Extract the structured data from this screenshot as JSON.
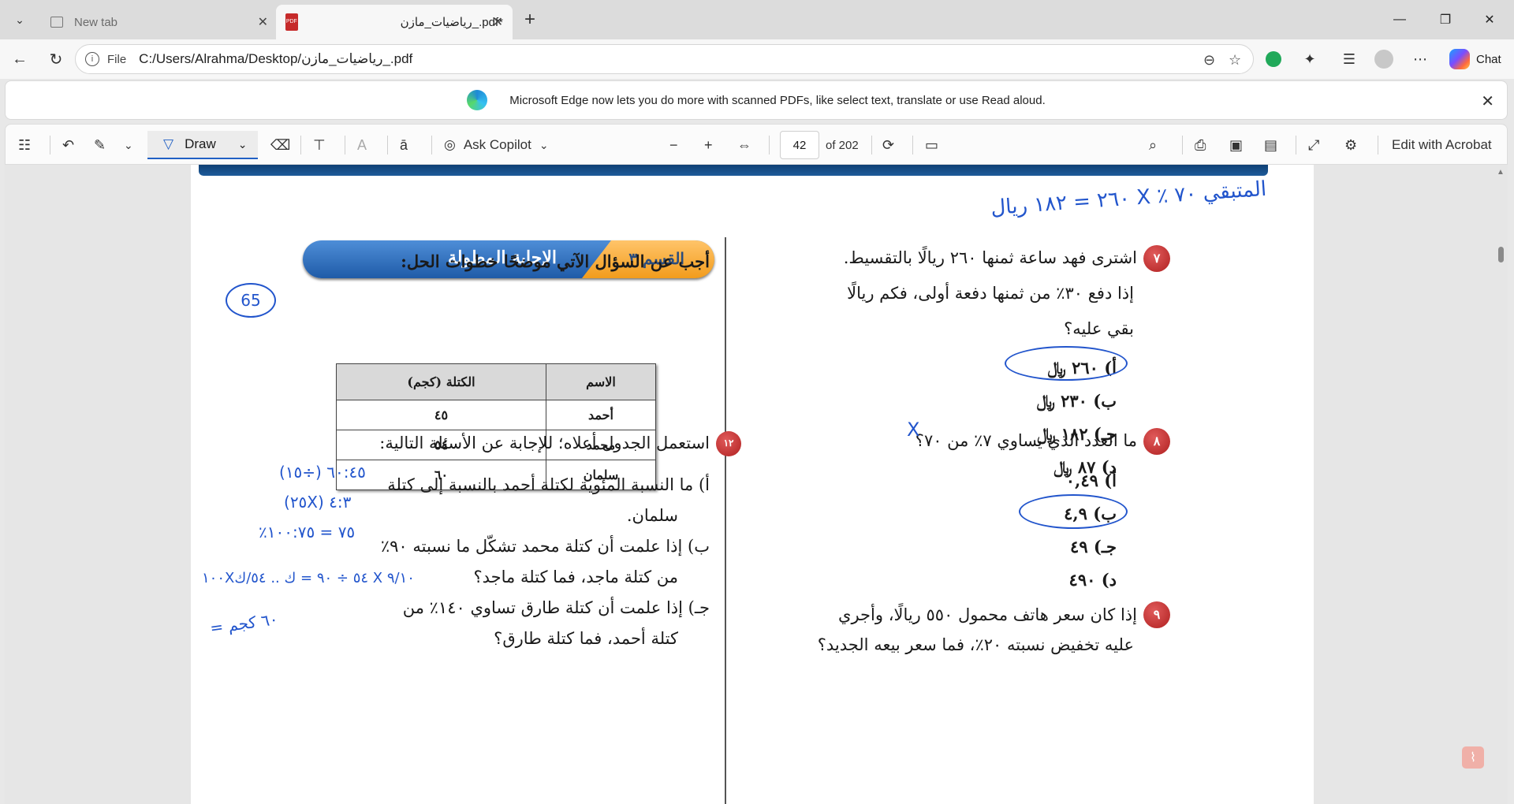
{
  "tabs": {
    "inactive": {
      "label": "New tab"
    },
    "active": {
      "label": "رياضيات_مازن_.pdf*"
    }
  },
  "address": {
    "scheme_label": "File",
    "url": "C:/Users/Alrahma/Desktop/رياضيات_مازن_.pdf"
  },
  "chat_label": "Chat",
  "infobar": {
    "message": "Microsoft Edge now lets you do more with scanned PDFs, like select text, translate or use Read aloud."
  },
  "pdf_toolbar": {
    "draw_label": "Draw",
    "copilot_label": "Ask Copilot",
    "page_current": "42",
    "page_total": "of 202",
    "acrobat_label": "Edit with Acrobat"
  },
  "colors": {
    "ink": "#2255cc",
    "accent": "#2160c4",
    "qnum": "#b02020"
  },
  "doc": {
    "right": {
      "q7": {
        "num": "٧",
        "line1": "اشترى فهد ساعة ثمنها ٢٦٠ ريالًا بالتقسيط.",
        "line2": "إذا دفع ٣٠٪ من ثمنها دفعة أولى، فكم ريالًا",
        "line3": "بقي عليه؟",
        "options": [
          "أ)  ٢٦٠ ﷼",
          "ب)  ٢٣٠ ﷼",
          "جـ)  ١٨٢ ﷼",
          "د)  ٨٧ ﷼"
        ]
      },
      "q8": {
        "num": "٨",
        "text": "ما العدد الذي يساوي ٧٪ من ٧٠؟",
        "options": [
          "أ)  ٠,٤٩",
          "ب)  ٤,٩",
          "جـ)  ٤٩",
          "د)  ٤٩٠"
        ]
      },
      "q9": {
        "num": "٩",
        "line1": "إذا كان سعر هاتف محمول ٥٥٠ ريالًا، وأجري",
        "line2": "عليه تخفيض نسبته ٢٠٪، فما سعر بيعه الجديد؟"
      }
    },
    "left": {
      "section_label": "القسم ٣",
      "section_title": "الإجابة المطولة",
      "instruction": "أجب عن السؤال الآتي موضحًا خطوات الحل:",
      "table": {
        "headers": [
          "الاسم",
          "الكتلة (كجم)"
        ],
        "rows": [
          [
            "أحمد",
            "٤٥"
          ],
          [
            "محمد",
            "٥٤"
          ],
          [
            "سلمان",
            "٦٠"
          ]
        ]
      },
      "q12": {
        "num": "١٢",
        "text": "استعمل الجدول أعلاه؛ للإجابة عن الأسئلة التالية:",
        "a1": "أ)   ما النسبة المئوية لكتلة أحمد بالنسبة إلى كتلة",
        "a2": "سلمان.",
        "b1": "ب)  إذا علمت أن كتلة محمد تشكّل ما نسبته ٩٠٪",
        "b2": "من كتلة ماجد، فما كتلة ماجد؟",
        "c1": "جـ)  إذا علمت أن كتلة طارق تساوي ١٤٠٪ من",
        "c2": "كتلة أحمد، فما كتلة طارق؟"
      }
    },
    "ink": {
      "top_note": "المتبقي ٧٠ ٪ X ٢٦٠ = ١٨٢ ريال",
      "circle_number": "65",
      "calc1": "(١٥÷) ٦٠:٤٥",
      "calc2": "(٢٥X) ٤:٣",
      "calc3": "٪٧٥ = ١٠٠:٧٥",
      "calc4": "١٠٠X٥٤ ÷ ٩٠ = ك .. ٥٤/ك X ٩/١٠",
      "calc5": "= ٦٠ كجم"
    }
  }
}
